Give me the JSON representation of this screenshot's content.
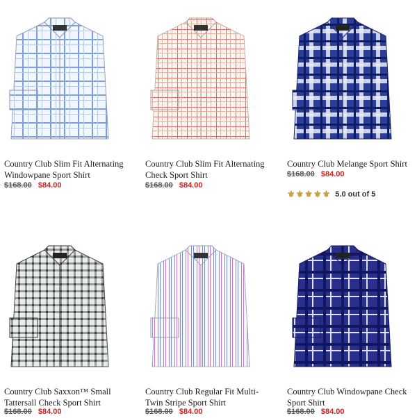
{
  "products": [
    {
      "name": "Country Club Slim Fit Alternating Windowpane Sport Shirt",
      "original_price": "$168.00",
      "sale_price": "$84.00",
      "colors": {
        "base": "#f3f6fb",
        "line1": "#7aa0d8",
        "line2": "#b7c9ea"
      }
    },
    {
      "name": "Country Club Slim Fit Alternating Check Sport Shirt",
      "original_price": "$168.00",
      "sale_price": "$84.00",
      "colors": {
        "base": "#fbf5f2",
        "line1": "#e06b64",
        "line2": "#e3b29a"
      }
    },
    {
      "name": "Country Club Melange Sport Shirt",
      "original_price": "$168.00",
      "sale_price": "$84.00",
      "rating_text": "5.0 out of 5",
      "rating_value": 5,
      "colors": {
        "base": "#2c3e9a",
        "line1": "#0e1c66",
        "line2": "#e9ecf7"
      }
    },
    {
      "name": "Country Club Saxxon™ Small Tattersall Check Sport Shirt",
      "original_price": "$168.00",
      "sale_price": "$84.00",
      "colors": {
        "base": "#e9ece9",
        "line1": "#3b423d",
        "line2": "#828a83"
      }
    },
    {
      "name": "Country Club Regular Fit Multi-Twin Stripe Sport Shirt",
      "original_price": "$168.00",
      "sale_price": "$84.00",
      "colors": {
        "base": "#f7f7fb",
        "line1": "#6f8fd6",
        "line2": "#c27ac8"
      }
    },
    {
      "name": "Country Club Windowpane Check Sport Shirt",
      "original_price": "$168.00",
      "sale_price": "$84.00",
      "colors": {
        "base": "#2a2f8e",
        "line1": "#101660",
        "line2": "#dfe3f4"
      }
    }
  ],
  "rating_icon": "fleur-de-lis-icon"
}
